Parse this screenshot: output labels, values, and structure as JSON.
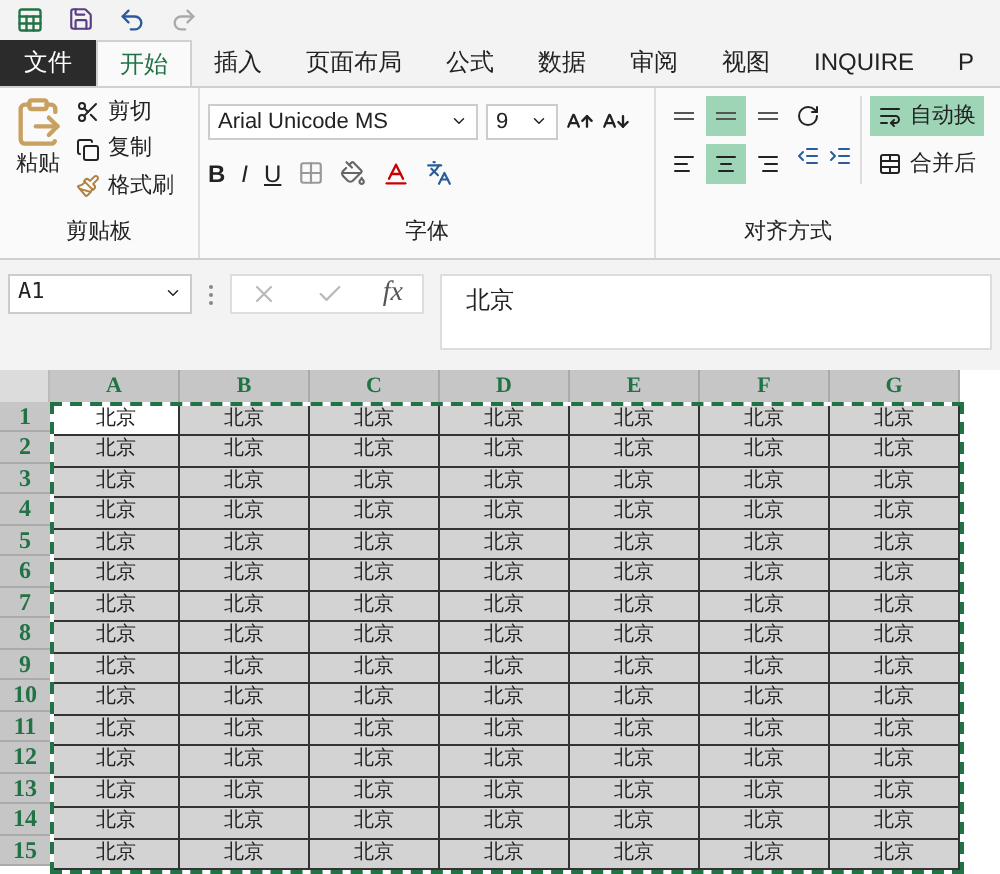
{
  "tabs": [
    {
      "label": "文件",
      "kind": "file",
      "selected": false
    },
    {
      "label": "开始",
      "kind": "tab",
      "selected": true
    },
    {
      "label": "插入",
      "kind": "tab",
      "selected": false
    },
    {
      "label": "页面布局",
      "kind": "tab",
      "selected": false
    },
    {
      "label": "公式",
      "kind": "tab",
      "selected": false
    },
    {
      "label": "数据",
      "kind": "tab",
      "selected": false
    },
    {
      "label": "审阅",
      "kind": "tab",
      "selected": false
    },
    {
      "label": "视图",
      "kind": "tab",
      "selected": false
    },
    {
      "label": "INQUIRE",
      "kind": "tab",
      "selected": false
    },
    {
      "label": "P",
      "kind": "tab",
      "selected": false
    }
  ],
  "clipboard": {
    "paste": "粘贴",
    "cut": "剪切",
    "copy": "复制",
    "format_painter": "格式刷",
    "label": "剪贴板"
  },
  "font": {
    "name": "Arial Unicode MS",
    "size": "9",
    "bold": "B",
    "italic": "I",
    "underline": "U",
    "label": "字体"
  },
  "alignment": {
    "vertical": [
      {
        "selected": false
      },
      {
        "selected": true
      },
      {
        "selected": false
      }
    ],
    "horizontal": [
      {
        "selected": false
      },
      {
        "selected": true
      },
      {
        "selected": false
      }
    ],
    "wrap": {
      "label": "自动换",
      "selected": true
    },
    "merge": {
      "label": "合并后"
    },
    "label": "对齐方式"
  },
  "name_box": "A1",
  "function_label": "fx",
  "formula": "北京",
  "columns": [
    "A",
    "B",
    "C",
    "D",
    "E",
    "F",
    "G"
  ],
  "rows": [
    {
      "header": "1",
      "cells": [
        {
          "text": "北京",
          "active": true
        },
        "北京",
        "北京",
        "北京",
        "北京",
        "北京",
        "北京"
      ]
    },
    {
      "header": "2",
      "cells": [
        "北京",
        "北京",
        "北京",
        "北京",
        "北京",
        "北京",
        "北京"
      ]
    },
    {
      "header": "3",
      "cells": [
        "北京",
        "北京",
        "北京",
        "北京",
        "北京",
        "北京",
        "北京"
      ]
    },
    {
      "header": "4",
      "cells": [
        "北京",
        "北京",
        "北京",
        "北京",
        "北京",
        "北京",
        "北京"
      ]
    },
    {
      "header": "5",
      "cells": [
        "北京",
        "北京",
        "北京",
        "北京",
        "北京",
        "北京",
        "北京"
      ]
    },
    {
      "header": "6",
      "cells": [
        "北京",
        "北京",
        "北京",
        "北京",
        "北京",
        "北京",
        "北京"
      ]
    },
    {
      "header": "7",
      "cells": [
        "北京",
        "北京",
        "北京",
        "北京",
        "北京",
        "北京",
        "北京"
      ]
    },
    {
      "header": "8",
      "cells": [
        "北京",
        "北京",
        "北京",
        "北京",
        "北京",
        "北京",
        "北京"
      ]
    },
    {
      "header": "9",
      "cells": [
        "北京",
        "北京",
        "北京",
        "北京",
        "北京",
        "北京",
        "北京"
      ]
    },
    {
      "header": "10",
      "cells": [
        "北京",
        "北京",
        "北京",
        "北京",
        "北京",
        "北京",
        "北京"
      ]
    },
    {
      "header": "11",
      "cells": [
        "北京",
        "北京",
        "北京",
        "北京",
        "北京",
        "北京",
        "北京"
      ]
    },
    {
      "header": "12",
      "cells": [
        "北京",
        "北京",
        "北京",
        "北京",
        "北京",
        "北京",
        "北京"
      ]
    },
    {
      "header": "13",
      "cells": [
        "北京",
        "北京",
        "北京",
        "北京",
        "北京",
        "北京",
        "北京"
      ]
    },
    {
      "header": "14",
      "cells": [
        "北京",
        "北京",
        "北京",
        "北京",
        "北京",
        "北京",
        "北京"
      ]
    },
    {
      "header": "15",
      "cells": [
        "北京",
        "北京",
        "北京",
        "北京",
        "北京",
        "北京",
        "北京"
      ]
    }
  ]
}
